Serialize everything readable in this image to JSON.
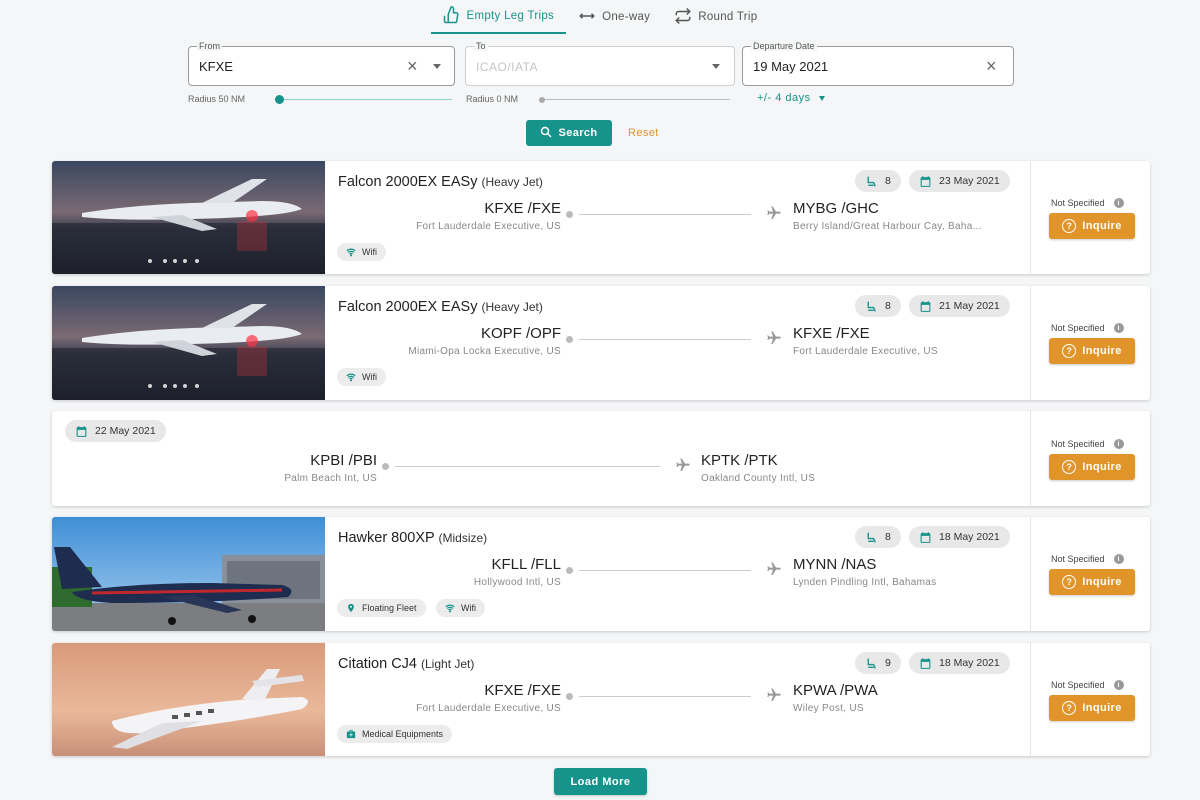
{
  "tabs": [
    {
      "label": "Empty Leg Trips",
      "icon": "thumb-up-icon",
      "active": true
    },
    {
      "label": "One-way",
      "icon": "arrow-both-icon"
    },
    {
      "label": "Round Trip",
      "icon": "repeat-icon"
    }
  ],
  "search": {
    "from_label": "From",
    "from_value": "KFXE",
    "to_label": "To",
    "to_placeholder": "ICAO/IATA",
    "date_label": "Departure Date",
    "date_value": "19 May 2021",
    "radius_from": "Radius 50 NM",
    "radius_to": "Radius 0 NM",
    "flex_days": "+/- 4 days",
    "search_label": "Search",
    "reset_label": "Reset"
  },
  "colors": {
    "accent": "#16938a",
    "action": "#e0942a"
  },
  "flights": [
    {
      "aircraft": "Falcon 2000EX EASy",
      "class": "(Heavy Jet)",
      "seats": "8",
      "date": "23 May 2021",
      "from_code": "KFXE /FXE",
      "from_city": "Fort Lauderdale Executive, US",
      "to_code": "MYBG /GHC",
      "to_city": "Berry Island/Great Harbour Cay, Baha...",
      "amenities": [
        "Wifi"
      ],
      "price": "Not Specified",
      "inquire": "Inquire"
    },
    {
      "aircraft": "Falcon 2000EX EASy",
      "class": "(Heavy Jet)",
      "seats": "8",
      "date": "21 May 2021",
      "from_code": "KOPF /OPF",
      "from_city": "Miami-Opa Locka Executive, US",
      "to_code": "KFXE /FXE",
      "to_city": "Fort Lauderdale Executive, US",
      "amenities": [
        "Wifi"
      ],
      "price": "Not Specified",
      "inquire": "Inquire"
    },
    {
      "date": "22 May 2021",
      "from_code": "KPBI /PBI",
      "from_city": "Palm Beach Int, US",
      "to_code": "KPTK /PTK",
      "to_city": "Oakland County Intl, US",
      "price": "Not Specified",
      "inquire": "Inquire"
    },
    {
      "aircraft": "Hawker 800XP",
      "class": "(Midsize)",
      "seats": "8",
      "date": "18 May 2021",
      "from_code": "KFLL /FLL",
      "from_city": "Hollywood Intl, US",
      "to_code": "MYNN /NAS",
      "to_city": "Lynden Pindling Intl, Bahamas",
      "amenities": [
        "Floating Fleet",
        "Wifi"
      ],
      "price": "Not Specified",
      "inquire": "Inquire"
    },
    {
      "aircraft": "Citation CJ4",
      "class": "(Light Jet)",
      "seats": "9",
      "date": "18 May 2021",
      "from_code": "KFXE /FXE",
      "from_city": "Fort Lauderdale Executive, US",
      "to_code": "KPWA /PWA",
      "to_city": "Wiley Post, US",
      "amenities": [
        "Medical Equipments"
      ],
      "price": "Not Specified",
      "inquire": "Inquire"
    }
  ],
  "load_more": "Load More"
}
